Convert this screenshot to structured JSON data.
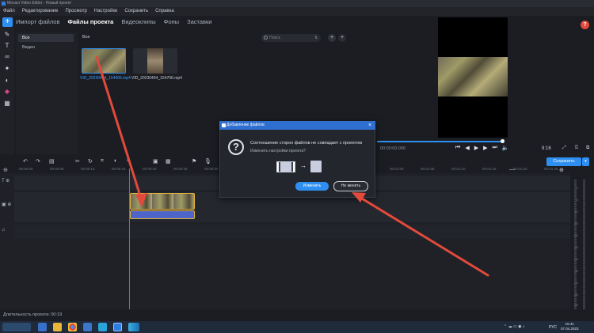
{
  "window": {
    "title": "Movavi Video Editor - Новый проект"
  },
  "menu": [
    "Файл",
    "Редактирование",
    "Просмотр",
    "Настройки",
    "Сохранить",
    "Справка"
  ],
  "tabs": {
    "import": "Импорт файлов",
    "project_files": "Файлы проекта",
    "video_clips": "Видеоклипы",
    "backgrounds": "Фоны",
    "intros": "Заставки"
  },
  "categories": {
    "all": "Все",
    "video": "Видео"
  },
  "files": {
    "section_label": "Все",
    "search_placeholder": "Поиск",
    "items": [
      {
        "name": "VID_20230404_154405.mp4",
        "selected": true
      },
      {
        "name": "VID_20230404_154706.mp4",
        "selected": false
      }
    ]
  },
  "preview": {
    "timecode": "00:00:00.000",
    "aspect": "9:16",
    "help": "?"
  },
  "toolbar": {
    "save_label": "Сохранить"
  },
  "ruler": [
    "00:00:00",
    "00:00:05",
    "00:00:10",
    "00:00:15",
    "00:00:20",
    "00:00:25",
    "00:00:30",
    "00:00:35",
    "00:00:40",
    "00:00:45",
    "00:00:50",
    "00:00:55",
    "00:01:00",
    "00:01:05",
    "00:01:10",
    "00:01:15",
    "00:01:20",
    "00:01:25"
  ],
  "meter_labels": [
    "0",
    "-5",
    "-10",
    "-15",
    "-20",
    "-25",
    "-30",
    "-35",
    "-40",
    "-45",
    "-50"
  ],
  "status": {
    "duration": "Длительность проекта: 00:19"
  },
  "dialog": {
    "title": "Добавление файлов",
    "message": "Соотношение сторон файлов не совпадает с проектом",
    "question": "Изменить настройки проекта?",
    "change_label": "Изменить",
    "keep_label": "Не менять"
  },
  "taskbar": {
    "lang": "РУС",
    "time": "15:41",
    "date": "07.04.2023"
  },
  "colors": {
    "accent": "#2f8ff0",
    "annotation_arrow": "#e24a3b",
    "clip_border": "#e3b43a"
  }
}
